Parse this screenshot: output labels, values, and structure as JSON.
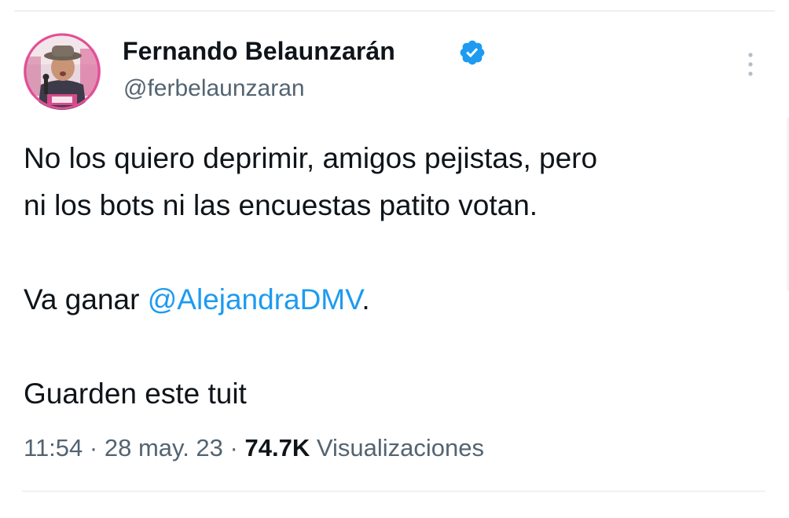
{
  "tweet": {
    "author": {
      "display_name": "Fernando Belaunzarán",
      "handle": "@ferbelaunzaran",
      "verified": true,
      "verified_badge_color": "#1d9bf0"
    },
    "text": {
      "line1": "No los quiero deprimir, amigos pejistas, pero",
      "line2": "ni los bots ni las encuestas patito votan.",
      "line3_prefix": "Va ganar ",
      "line3_mention": "@AlejandraDMV",
      "line3_suffix": ".",
      "line4": "Guarden este tuit"
    },
    "meta": {
      "time": "11:54",
      "sep1": " · ",
      "date": "28 may. 23",
      "sep2": " · ",
      "views_count": "74.7K",
      "views_label": " Visualizaciones"
    },
    "colors": {
      "text": "#0f1419",
      "secondary": "#536471",
      "link": "#1d9bf0"
    },
    "icons": {
      "more": "more-vertical-icon",
      "verified": "verified-badge-icon"
    }
  }
}
